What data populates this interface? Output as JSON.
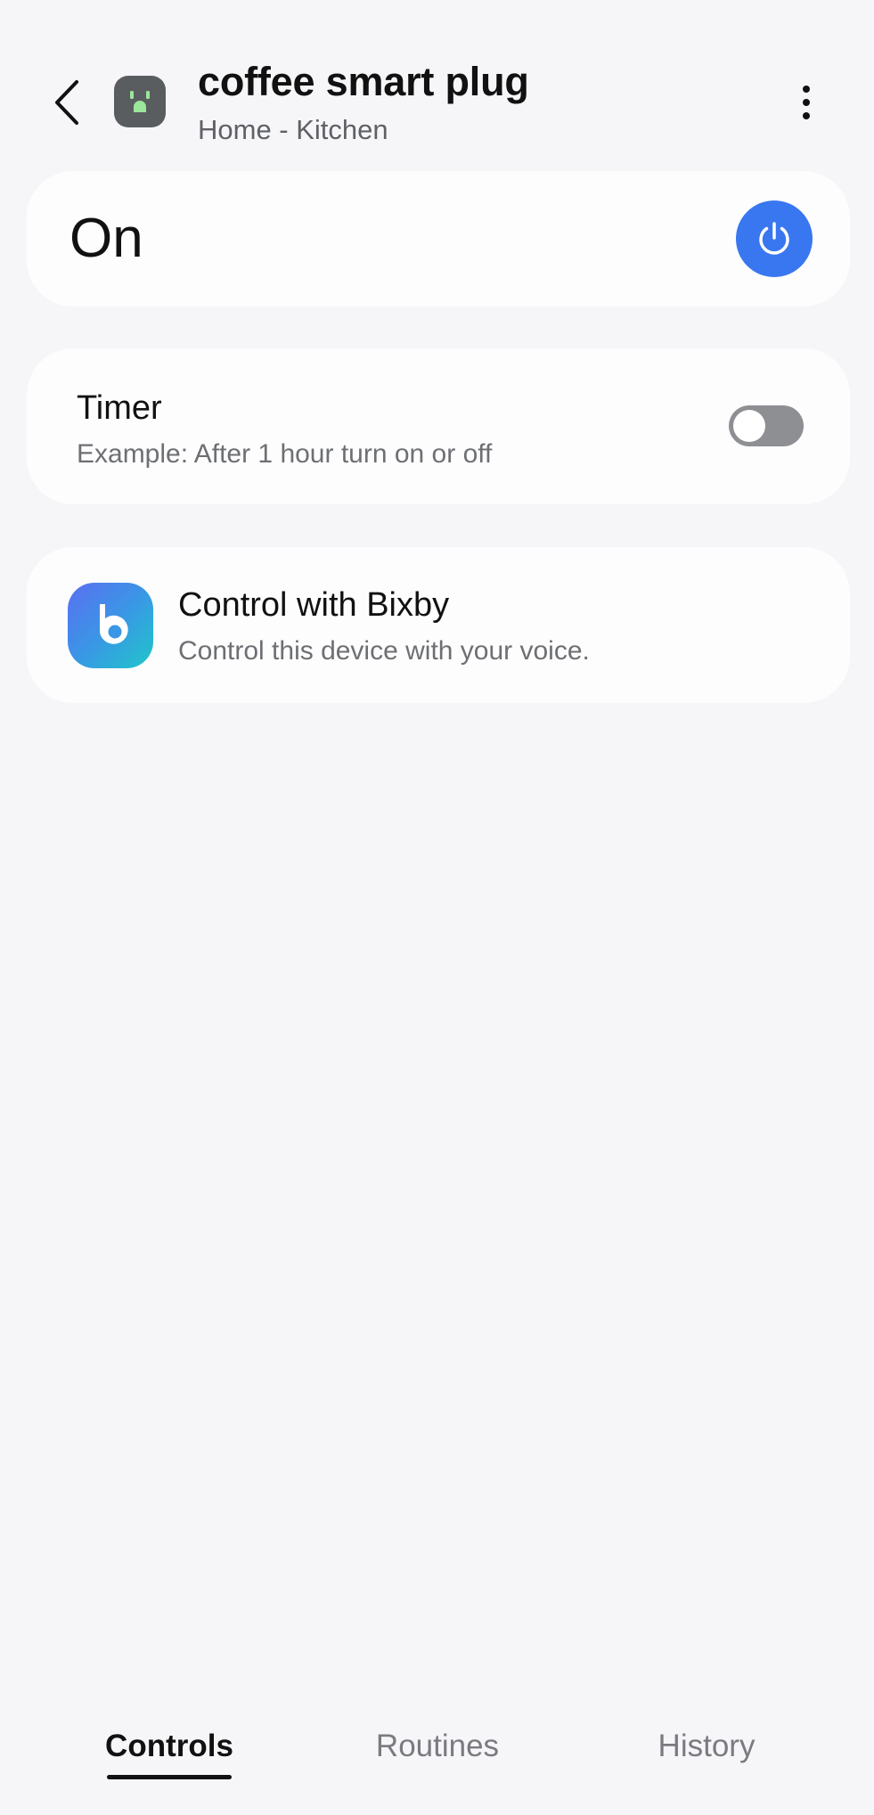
{
  "header": {
    "title": "coffee smart plug",
    "subtitle": "Home - Kitchen",
    "back_icon": "chevron-left-icon",
    "device_icon": "smart-plug-icon",
    "more_icon": "more-vertical-icon"
  },
  "power": {
    "state_label": "On",
    "button_icon": "power-icon",
    "accent_color": "#3877ef"
  },
  "timer": {
    "title": "Timer",
    "description": "Example: After 1 hour turn on or off",
    "enabled": false
  },
  "bixby": {
    "title": "Control with Bixby",
    "description": "Control this device with your voice.",
    "icon": "bixby-icon"
  },
  "tabs": [
    {
      "label": "Controls",
      "active": true
    },
    {
      "label": "Routines",
      "active": false
    },
    {
      "label": "History",
      "active": false
    }
  ]
}
